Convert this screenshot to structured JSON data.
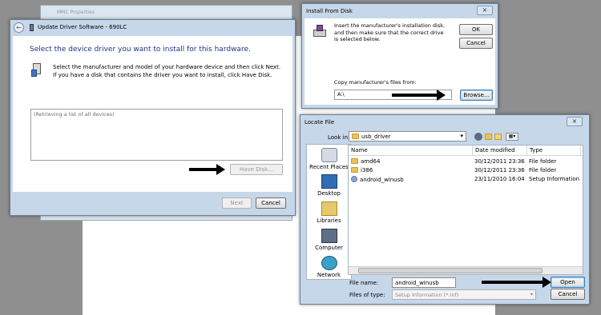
{
  "background_window": {
    "title": "MMC Properties"
  },
  "update_driver": {
    "title": "Update Driver Software - 690LC",
    "heading": "Select the device driver you want to install for this hardware.",
    "instructions": "Select the manufacturer and model of your hardware device and then click Next. If you have a disk that contains the driver you want to install, click Have Disk.",
    "list_placeholder": "(Retrieving a list of all devices)",
    "have_disk_label": "Have Disk...",
    "next_label": "Next",
    "cancel_label": "Cancel"
  },
  "install_from_disk": {
    "title": "Install From Disk",
    "message": "Insert the manufacturer's installation disk, and then make sure that the correct drive is selected below.",
    "ok_label": "OK",
    "cancel_label": "Cancel",
    "copy_label": "Copy manufacturer's files from:",
    "path_value": "A:\\",
    "browse_label": "Browse..."
  },
  "locate_file": {
    "title": "Locate File",
    "look_in_label": "Look in:",
    "look_in_value": "usb_driver",
    "places": [
      {
        "label": "Recent Places",
        "icon": "recent-places-icon"
      },
      {
        "label": "Desktop",
        "icon": "desktop-icon"
      },
      {
        "label": "Libraries",
        "icon": "libraries-icon"
      },
      {
        "label": "Computer",
        "icon": "computer-icon"
      },
      {
        "label": "Network",
        "icon": "network-icon"
      }
    ],
    "columns": [
      "Name",
      "Date modified",
      "Type",
      "S"
    ],
    "rows": [
      {
        "name": "amd64",
        "date": "30/12/2011 23:36",
        "type": "File folder",
        "icon": "folder-icon"
      },
      {
        "name": "i386",
        "date": "30/12/2011 23:36",
        "type": "File folder",
        "icon": "folder-icon"
      },
      {
        "name": "android_winusb",
        "date": "23/11/2010 16:04",
        "type": "Setup Information",
        "icon": "setup-file-icon"
      }
    ],
    "file_name_label": "File name:",
    "file_name_value": "android_winusb",
    "files_of_type_label": "Files of type:",
    "files_of_type_value": "Setup Information (*.inf)",
    "open_label": "Open",
    "cancel_label": "Cancel"
  }
}
